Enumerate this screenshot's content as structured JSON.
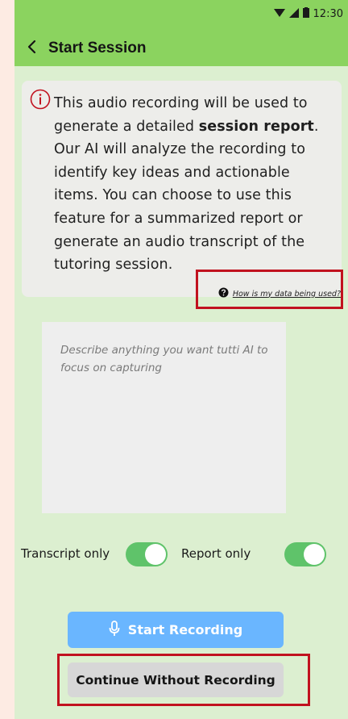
{
  "status_bar": {
    "time": "12:30"
  },
  "header": {
    "title": "Start Session",
    "back_icon": "chevron-left-icon"
  },
  "info_card": {
    "icon": "info-icon",
    "text_before_bold_1": "This audio recording will be used to generate a detailed ",
    "bold_1": "session report",
    "text_after_bold_1": ". Our AI will analyze the recording to identify key ideas and actionable items. You can choose to use this feature for a summarized report or generate an audio transcript of the tutoring session.",
    "help_link": "How is my data being used?"
  },
  "focus_input": {
    "placeholder": "Describe anything you want tutti AI to focus on capturing",
    "value": ""
  },
  "toggles": [
    {
      "label": "Transcript only",
      "on": true
    },
    {
      "label": "Report only",
      "on": true
    }
  ],
  "buttons": {
    "start_recording": "Start Recording",
    "continue_without": "Continue Without Recording"
  },
  "colors": {
    "header": "#8bd35f",
    "content_bg": "#dcefd0",
    "page_bg": "#fdebe3",
    "toggle_on": "#5fc36a",
    "primary_button": "#6ab6ff",
    "secondary_button": "#d7d7d7",
    "highlight_border": "#c1121f",
    "info_icon": "#c1121f"
  }
}
